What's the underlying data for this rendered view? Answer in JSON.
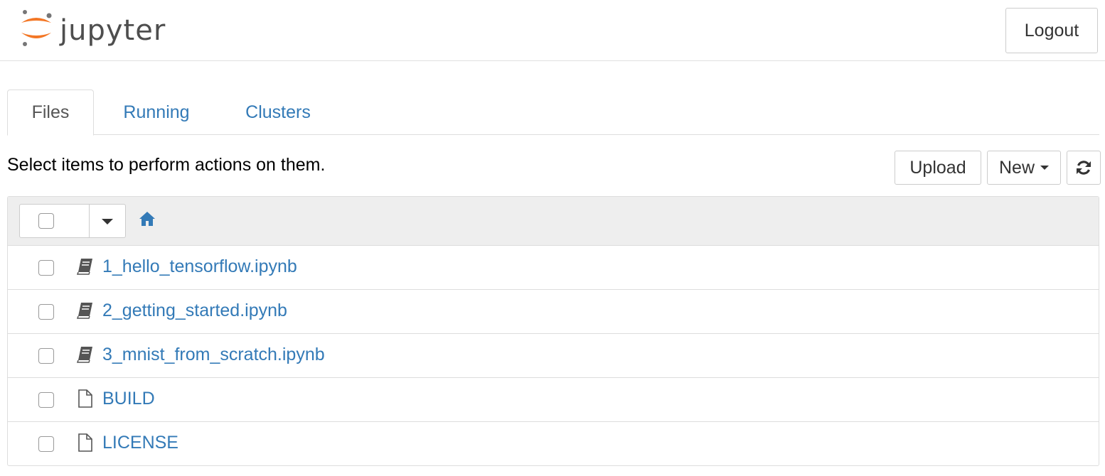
{
  "header": {
    "logo_text": "jupyter",
    "logout_label": "Logout"
  },
  "tabs": [
    {
      "label": "Files",
      "active": true
    },
    {
      "label": "Running",
      "active": false
    },
    {
      "label": "Clusters",
      "active": false
    }
  ],
  "toolbar": {
    "hint": "Select items to perform actions on them.",
    "upload_label": "Upload",
    "new_label": "New",
    "refresh_icon": "refresh-icon"
  },
  "breadcrumb": {
    "home_icon": "home-icon"
  },
  "files": [
    {
      "name": "1_hello_tensorflow.ipynb",
      "icon": "notebook-icon"
    },
    {
      "name": "2_getting_started.ipynb",
      "icon": "notebook-icon"
    },
    {
      "name": "3_mnist_from_scratch.ipynb",
      "icon": "notebook-icon"
    },
    {
      "name": "BUILD",
      "icon": "file-icon"
    },
    {
      "name": "LICENSE",
      "icon": "file-icon"
    }
  ],
  "colors": {
    "link": "#337ab7",
    "logo_orange": "#f37726",
    "logo_gray": "#767677",
    "header_bg": "#eeeeee"
  }
}
